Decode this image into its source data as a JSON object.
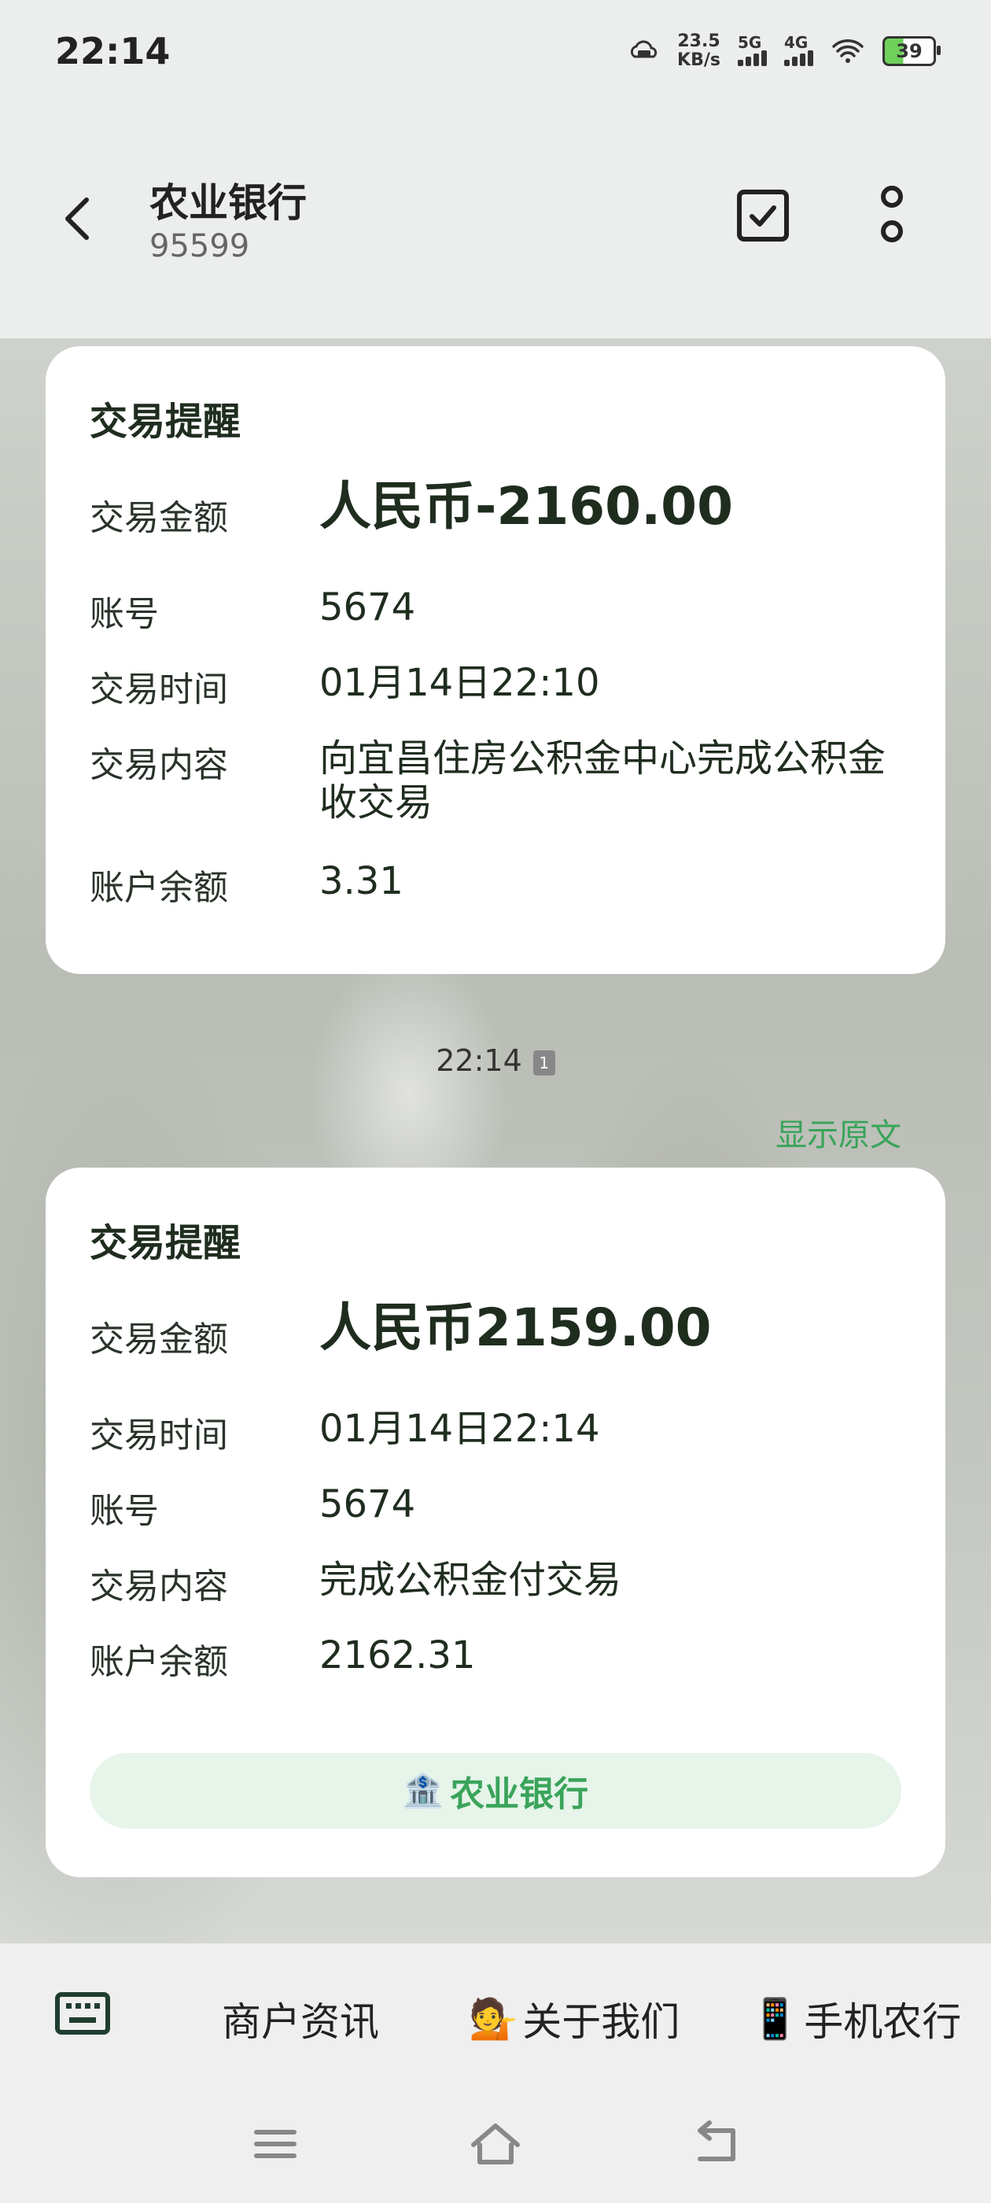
{
  "status_bar": {
    "time": "22:14",
    "net_speed_value": "23.5",
    "net_speed_unit": "KB/s",
    "signal1_label": "5G",
    "signal2_label": "4G",
    "battery": "39"
  },
  "header": {
    "title": "农业银行",
    "subtitle": "95599"
  },
  "messages": [
    {
      "title": "交易提醒",
      "amount_label": "交易金额",
      "amount_value": "人民币-2160.00",
      "rows": [
        {
          "label": "账号",
          "value": "5674"
        },
        {
          "label": "交易时间",
          "value": "01月14日22:10"
        },
        {
          "label": "交易内容",
          "value": "向宜昌住房公积金中心完成公积金收交易"
        },
        {
          "label": "账户余额",
          "value": "3.31"
        }
      ]
    },
    {
      "title": "交易提醒",
      "amount_label": "交易金额",
      "amount_value": "人民币2159.00",
      "rows": [
        {
          "label": "交易时间",
          "value": "01月14日22:14"
        },
        {
          "label": "账号",
          "value": "5674"
        },
        {
          "label": "交易内容",
          "value": "完成公积金付交易"
        },
        {
          "label": "账户余额",
          "value": "2162.31"
        }
      ],
      "bank_button": "农业银行",
      "bank_button_emoji": "🏦"
    }
  ],
  "timestamp": "22:14",
  "sim_badge": "1",
  "show_original": "显示原文",
  "bottom_menu": {
    "item1": "商户资讯",
    "item2_emoji": "💁",
    "item2": "关于我们",
    "item3_emoji": "📱",
    "item3": "手机农行"
  },
  "colors": {
    "accent_green": "#3aa45a",
    "card_bg": "#ffffff",
    "page_bg": "#eceeed"
  }
}
